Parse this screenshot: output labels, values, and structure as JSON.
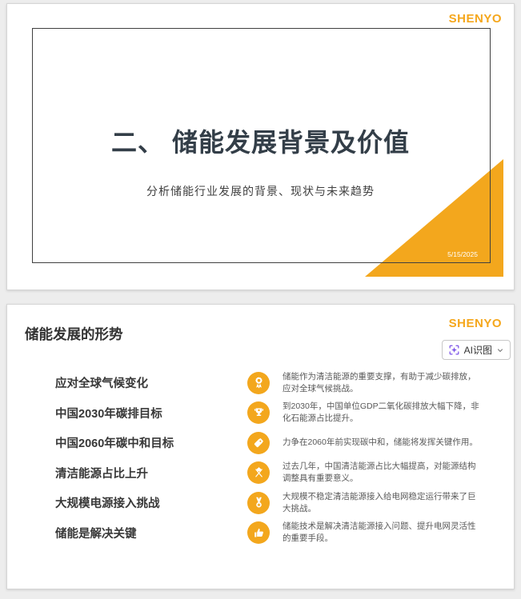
{
  "brand": {
    "logo": "SHENYO"
  },
  "colors": {
    "accent_orange": "#f3a71d",
    "logo_orange": "#f5a71c",
    "ai_purple": "#7b52e8",
    "frame_border": "#404040"
  },
  "slide1": {
    "title": "二、 储能发展背景及价值",
    "subtitle": "分析储能行业发展的背景、现状与未来趋势",
    "date": "5/15/2025"
  },
  "slide2": {
    "title": "储能发展的形势",
    "ai_button": {
      "label": "AI识图",
      "icon": "ai-scan-sparkle-icon",
      "chevron": "chevron-down-icon"
    },
    "items": [
      {
        "label": "应对全球气候变化",
        "icon": "award-ribbon-icon",
        "desc": "储能作为清洁能源的重要支撑，有助于减少碳排放，应对全球气候挑战。"
      },
      {
        "label": "中国2030年碳排目标",
        "icon": "trophy-icon",
        "desc": "到2030年，中国单位GDP二氧化碳排放大幅下降，非化石能源占比提升。"
      },
      {
        "label": "中国2060年碳中和目标",
        "icon": "tag-icon",
        "desc": "力争在2060年前实现碳中和，储能将发挥关键作用。"
      },
      {
        "label": "清洁能源占比上升",
        "icon": "crossed-flags-icon",
        "desc": "过去几年，中国清洁能源占比大幅提高，对能源结构调整具有重要意义。"
      },
      {
        "label": "大规模电源接入挑战",
        "icon": "medal-icon",
        "desc": "大规模不稳定清洁能源接入给电网稳定运行带来了巨大挑战。"
      },
      {
        "label": "储能是解决关键",
        "icon": "thumbs-up-icon",
        "desc": "储能技术是解决清洁能源接入问题、提升电网灵活性的重要手段。"
      }
    ]
  }
}
